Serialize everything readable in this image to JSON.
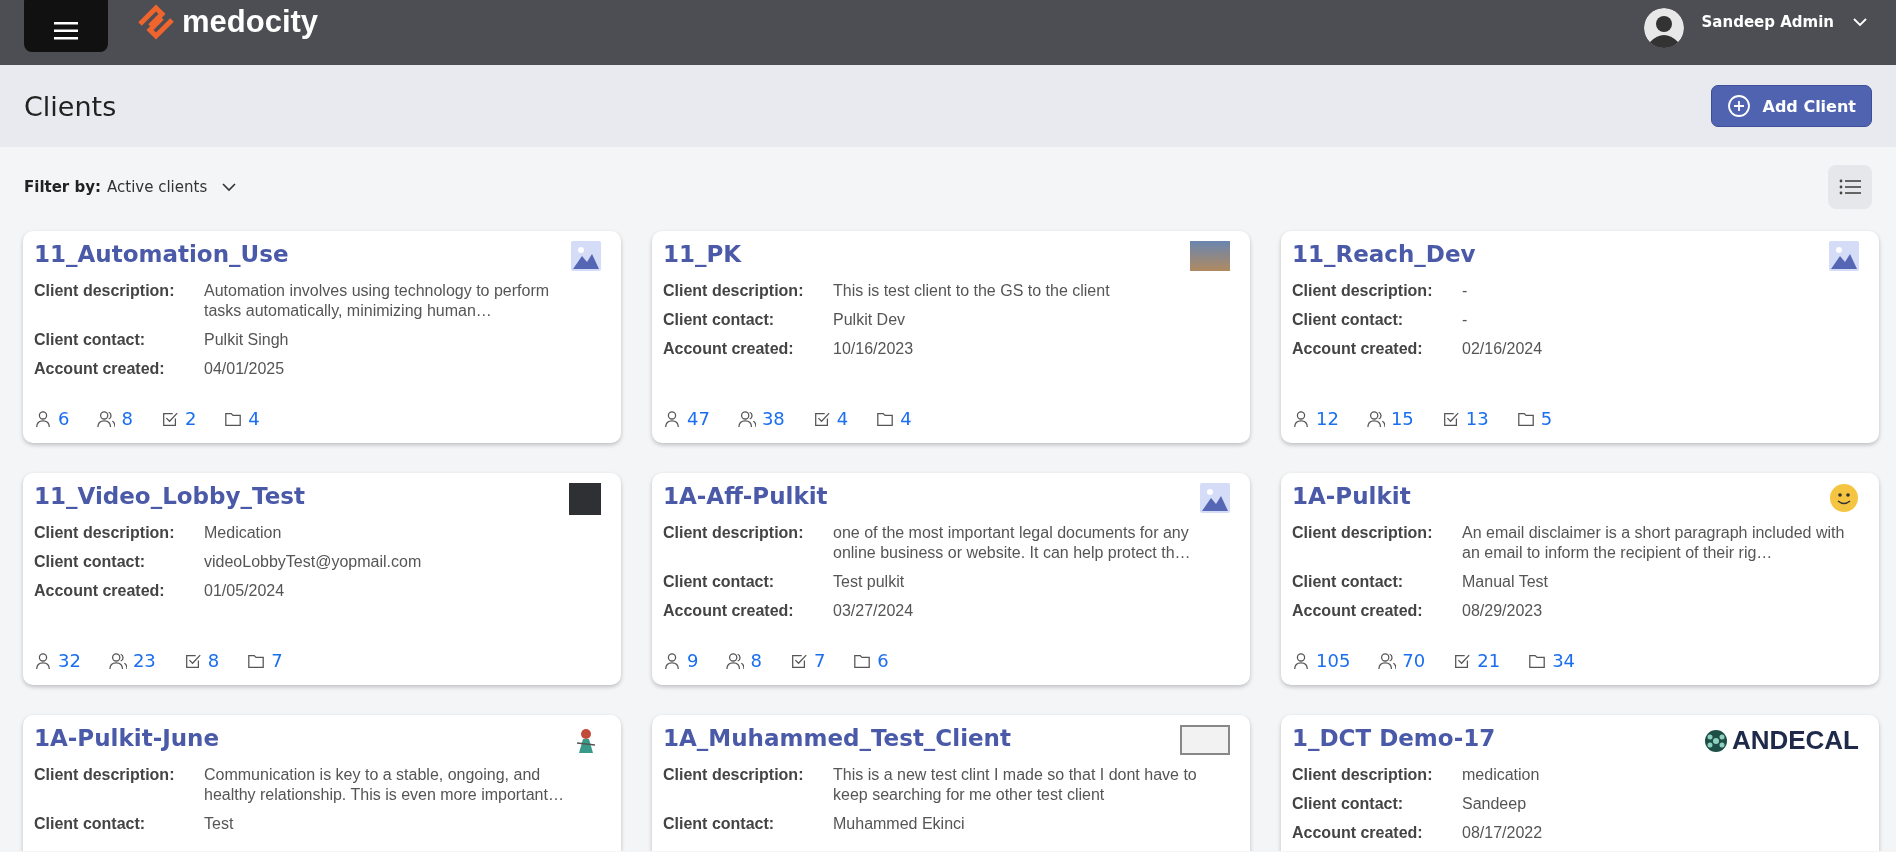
{
  "header": {
    "brand": "medocity",
    "user": "Sandeep Admin"
  },
  "page": {
    "title": "Clients",
    "add_button": "Add Client"
  },
  "filter": {
    "label": "Filter by:",
    "value": "Active clients"
  },
  "clients": [
    {
      "name": "11_Automation_Use",
      "thumb": {
        "kind": "placeholder"
      },
      "fields": [
        {
          "label": "Client description:",
          "value": "Automation involves using technology to perform tasks automatically, minimizing human…"
        },
        {
          "label": "Client contact:",
          "value": "Pulkit Singh"
        },
        {
          "label": "Account created:",
          "value": "04/01/2025"
        }
      ],
      "stats": [
        "6",
        "8",
        "2",
        "4"
      ]
    },
    {
      "name": "11_PK",
      "thumb": {
        "kind": "photo"
      },
      "fields": [
        {
          "label": "Client description:",
          "value": "This is test client to the GS to the client"
        },
        {
          "label": "Client contact:",
          "value": "Pulkit Dev"
        },
        {
          "label": "Account created:",
          "value": "10/16/2023"
        }
      ],
      "stats": [
        "47",
        "38",
        "4",
        "4"
      ]
    },
    {
      "name": "11_Reach_Dev",
      "thumb": {
        "kind": "placeholder"
      },
      "fields": [
        {
          "label": "Client description:",
          "value": "-"
        },
        {
          "label": "Client contact:",
          "value": "-"
        },
        {
          "label": "Account created:",
          "value": "02/16/2024"
        }
      ],
      "stats": [
        "12",
        "15",
        "13",
        "5"
      ]
    },
    {
      "name": "11_Video_Lobby_Test",
      "thumb": {
        "kind": "dark"
      },
      "fields": [
        {
          "label": "Client description:",
          "value": "Medication"
        },
        {
          "label": "Client contact:",
          "value": "videoLobbyTest@yopmail.com"
        },
        {
          "label": "Account created:",
          "value": "01/05/2024"
        }
      ],
      "stats": [
        "32",
        "23",
        "8",
        "7"
      ]
    },
    {
      "name": "1A-Aff-Pulkit",
      "thumb": {
        "kind": "placeholder"
      },
      "fields": [
        {
          "label": "Client description:",
          "value": "one of the most important legal documents for any online business or website. It can help protect th…"
        },
        {
          "label": "Client contact:",
          "value": "Test pulkit"
        },
        {
          "label": "Account created:",
          "value": "03/27/2024"
        }
      ],
      "stats": [
        "9",
        "8",
        "7",
        "6"
      ]
    },
    {
      "name": "1A-Pulkit",
      "thumb": {
        "kind": "smiley"
      },
      "fields": [
        {
          "label": "Client description:",
          "value": "An email disclaimer is a short paragraph included with an email to inform the recipient of their rig…"
        },
        {
          "label": "Client contact:",
          "value": "Manual Test"
        },
        {
          "label": "Account created:",
          "value": "08/29/2023"
        }
      ],
      "stats": [
        "105",
        "70",
        "21",
        "34"
      ]
    },
    {
      "name": "1A-Pulkit-June",
      "thumb": {
        "kind": "drawing"
      },
      "fields": [
        {
          "label": "Client description:",
          "value": "Communication is key to a stable, ongoing, and healthy relationship. This is even more important…"
        },
        {
          "label": "Client contact:",
          "value": "Test"
        }
      ]
    },
    {
      "name": "1A_Muhammed_Test_Client",
      "thumb": {
        "kind": "document"
      },
      "fields": [
        {
          "label": "Client description:",
          "value": "This is a new test clint I made so that I dont have to keep searching for me other test client"
        },
        {
          "label": "Client contact:",
          "value": "Muhammed Ekinci"
        }
      ]
    },
    {
      "name": "1_DCT Demo-17",
      "thumb": {
        "kind": "logo",
        "text": "ANDECAL"
      },
      "fields": [
        {
          "label": "Client description:",
          "value": "medication"
        },
        {
          "label": "Client contact:",
          "value": "Sandeep"
        },
        {
          "label": "Account created:",
          "value": "08/17/2022"
        }
      ]
    }
  ]
}
